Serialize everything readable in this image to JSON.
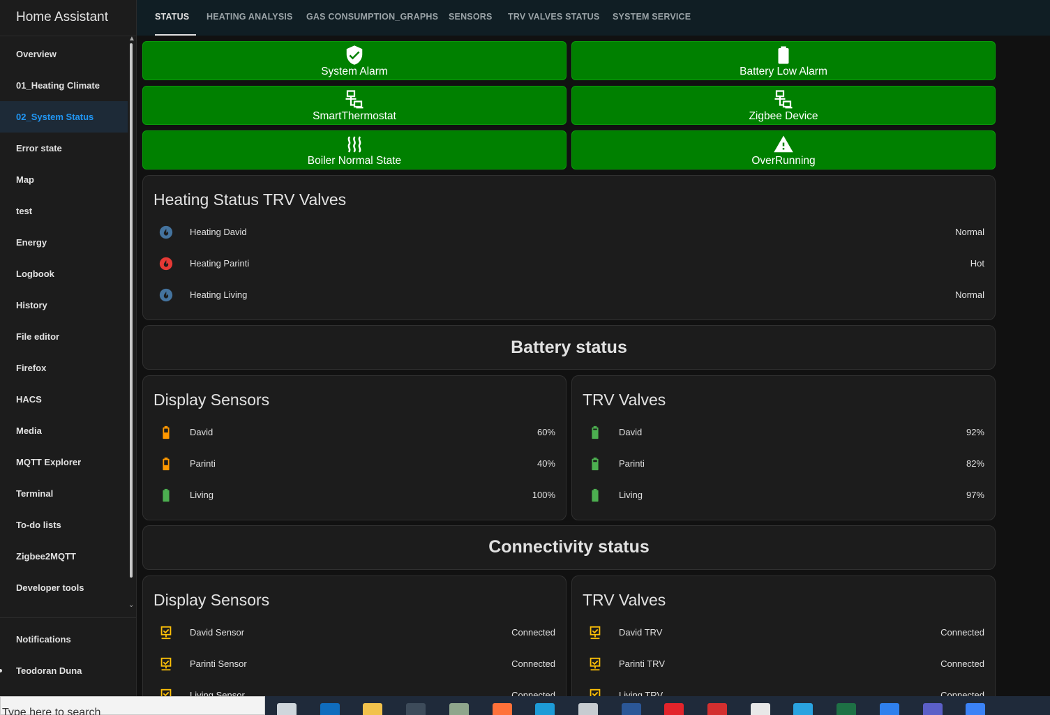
{
  "sidebar": {
    "title": "Home Assistant",
    "items": [
      {
        "label": "Overview",
        "active": false
      },
      {
        "label": "01_Heating Climate",
        "active": false
      },
      {
        "label": "02_System Status",
        "active": true
      },
      {
        "label": "Error state",
        "active": false
      },
      {
        "label": "Map",
        "active": false
      },
      {
        "label": "test",
        "active": false
      },
      {
        "label": "Energy",
        "active": false
      },
      {
        "label": "Logbook",
        "active": false
      },
      {
        "label": "History",
        "active": false
      },
      {
        "label": "File editor",
        "active": false
      },
      {
        "label": "Firefox",
        "active": false
      },
      {
        "label": "HACS",
        "active": false
      },
      {
        "label": "Media",
        "active": false
      },
      {
        "label": "MQTT Explorer",
        "active": false
      },
      {
        "label": "Terminal",
        "active": false
      },
      {
        "label": "To-do lists",
        "active": false
      },
      {
        "label": "Zigbee2MQTT",
        "active": false
      },
      {
        "label": "Developer tools",
        "active": false
      }
    ],
    "notifications": "Notifications",
    "user": "Teodoran Duna"
  },
  "tabs": [
    "STATUS",
    "HEATING ANALYSIS",
    "GAS CONSUMPTION_GRAPHS",
    "SENSORS",
    "TRV VALVES STATUS",
    "SYSTEM SERVICE"
  ],
  "status_buttons": [
    {
      "label": "System Alarm",
      "icon": "shield-check-icon"
    },
    {
      "label": "Battery Low Alarm",
      "icon": "battery-icon"
    },
    {
      "label": "SmartThermostat",
      "icon": "lan-icon"
    },
    {
      "label": "Zigbee Device",
      "icon": "lan-icon"
    },
    {
      "label": "Boiler Normal State",
      "icon": "heat-waves-icon"
    },
    {
      "label": "OverRunning",
      "icon": "warning-icon"
    }
  ],
  "heating_card": {
    "title": "Heating Status TRV Valves",
    "rows": [
      {
        "name": "Heating David",
        "value": "Normal",
        "icon": "fire-circle-icon",
        "color": "#44739e"
      },
      {
        "name": "Heating Parinti",
        "value": "Hot",
        "icon": "fire-circle-icon",
        "color": "#e53935"
      },
      {
        "name": "Heating Living",
        "value": "Normal",
        "icon": "fire-circle-icon",
        "color": "#44739e"
      }
    ]
  },
  "battery_header": "Battery status",
  "battery_display": {
    "title": "Display Sensors",
    "rows": [
      {
        "name": "David",
        "value": "60%",
        "icon": "battery-icon",
        "color": "#ff9800",
        "level": 0.6
      },
      {
        "name": "Parinti",
        "value": "40%",
        "icon": "battery-icon",
        "color": "#ff9800",
        "level": 0.4
      },
      {
        "name": "Living",
        "value": "100%",
        "icon": "battery-icon",
        "color": "#4caf50",
        "level": 1.0
      }
    ]
  },
  "battery_trv": {
    "title": "TRV Valves",
    "rows": [
      {
        "name": "David",
        "value": "92%",
        "icon": "battery-icon",
        "color": "#4caf50",
        "level": 0.92
      },
      {
        "name": "Parinti",
        "value": "82%",
        "icon": "battery-icon",
        "color": "#4caf50",
        "level": 0.82
      },
      {
        "name": "Living",
        "value": "97%",
        "icon": "battery-icon",
        "color": "#4caf50",
        "level": 0.97
      }
    ]
  },
  "connectivity_header": "Connectivity status",
  "conn_display": {
    "title": "Display Sensors",
    "rows": [
      {
        "name": "David Sensor",
        "value": "Connected",
        "icon": "lan-connect-icon"
      },
      {
        "name": "Parinti Sensor",
        "value": "Connected",
        "icon": "lan-connect-icon"
      },
      {
        "name": "Living Sensor",
        "value": "Connected",
        "icon": "lan-connect-icon"
      }
    ]
  },
  "conn_trv": {
    "title": "TRV Valves",
    "rows": [
      {
        "name": "David TRV",
        "value": "Connected",
        "icon": "lan-connect-icon"
      },
      {
        "name": "Parinti TRV",
        "value": "Connected",
        "icon": "lan-connect-icon"
      },
      {
        "name": "Living TRV",
        "value": "Connected",
        "icon": "lan-connect-icon"
      }
    ]
  },
  "taskbar": {
    "search_placeholder": "Type here to search",
    "apps": [
      "task-view-icon",
      "outlook-icon",
      "file-explorer-icon",
      "terminal-icon",
      "notepad-icon",
      "firefox-icon",
      "edge-icon",
      "paint-icon",
      "word-icon",
      "opera-icon",
      "acrobat-icon",
      "vpn-icon",
      "telegram-icon",
      "excel-icon",
      "vscode-icon",
      "teams-icon",
      "photos-icon"
    ]
  },
  "colors": {
    "accent": "#2196f3",
    "alarm_ok": "#008000",
    "connected_icon": "#ffc107"
  }
}
